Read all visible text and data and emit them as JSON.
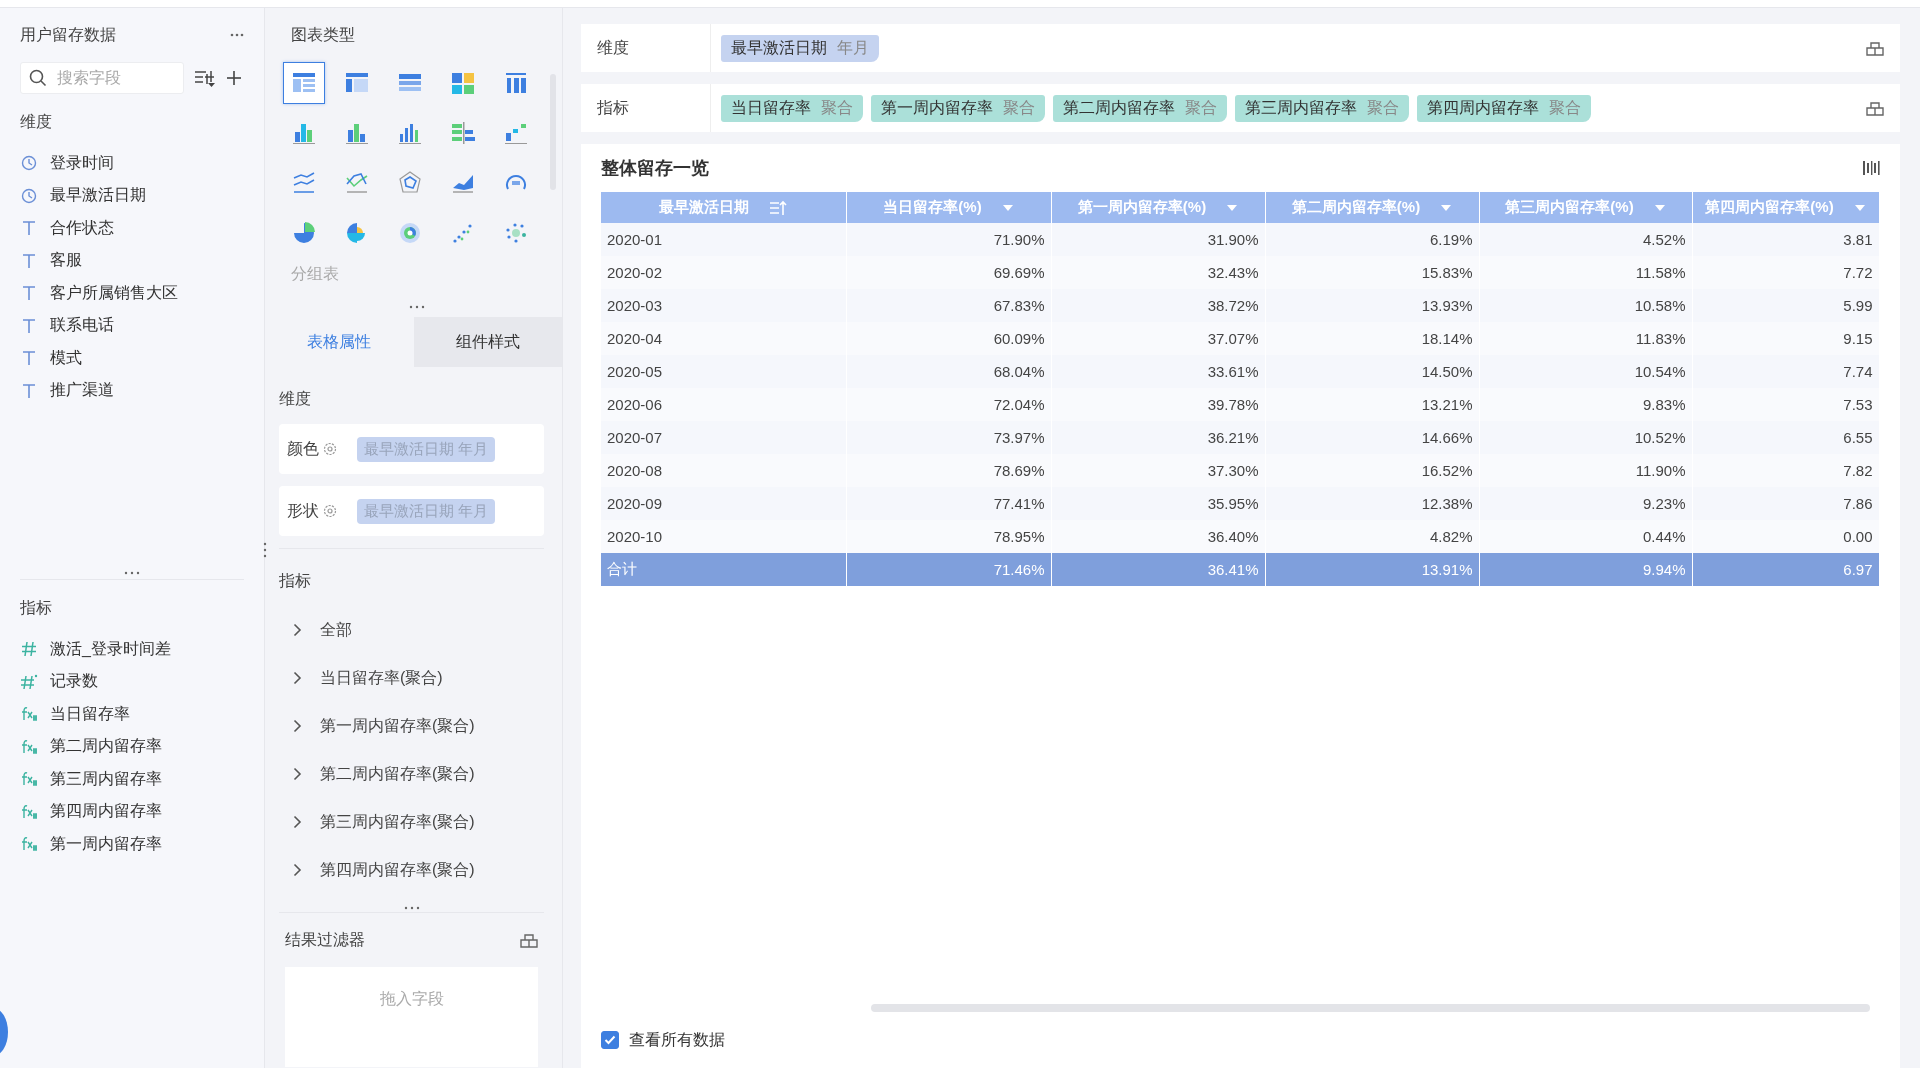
{
  "source": {
    "title": "用户留存数据",
    "search_placeholder": "搜索字段"
  },
  "dimensions": {
    "label": "维度",
    "items": [
      {
        "kind": "date",
        "name": "登录时间"
      },
      {
        "kind": "date",
        "name": "最早激活日期"
      },
      {
        "kind": "text",
        "name": "合作状态"
      },
      {
        "kind": "text",
        "name": "客服"
      },
      {
        "kind": "text",
        "name": "客户所属销售大区"
      },
      {
        "kind": "text",
        "name": "联系电话"
      },
      {
        "kind": "text",
        "name": "模式"
      },
      {
        "kind": "text",
        "name": "推广渠道"
      }
    ]
  },
  "measures": {
    "label": "指标",
    "items": [
      {
        "kind": "number",
        "name": "激活_登录时间差"
      },
      {
        "kind": "count",
        "name": "记录数"
      },
      {
        "kind": "calc",
        "name": "当日留存率"
      },
      {
        "kind": "calc",
        "name": "第二周内留存率"
      },
      {
        "kind": "calc",
        "name": "第三周内留存率"
      },
      {
        "kind": "calc",
        "name": "第四周内留存率"
      },
      {
        "kind": "calc",
        "name": "第一周内留存率"
      }
    ]
  },
  "chart_panel": {
    "title": "图表类型",
    "hint": "分组表",
    "types": [
      {
        "kind": "table",
        "selected": true
      },
      {
        "kind": "cross-table",
        "selected": false
      },
      {
        "kind": "detail-table",
        "selected": false
      },
      {
        "kind": "treemap",
        "selected": false
      },
      {
        "kind": "kpi",
        "selected": false
      },
      {
        "kind": "stacked-column",
        "selected": false
      },
      {
        "kind": "column",
        "selected": false
      },
      {
        "kind": "grouped-column",
        "selected": false
      },
      {
        "kind": "bar",
        "selected": false
      },
      {
        "kind": "waterfall",
        "selected": false
      },
      {
        "kind": "multi-line",
        "selected": false
      },
      {
        "kind": "cross-line",
        "selected": false
      },
      {
        "kind": "radar",
        "selected": false
      },
      {
        "kind": "area",
        "selected": false
      },
      {
        "kind": "gauge",
        "selected": false
      },
      {
        "kind": "pie",
        "selected": false
      },
      {
        "kind": "rose",
        "selected": false
      },
      {
        "kind": "sunburst",
        "selected": false
      },
      {
        "kind": "scatter",
        "selected": false
      },
      {
        "kind": "bubble",
        "selected": false
      }
    ]
  },
  "tabs": [
    {
      "label": "表格属性",
      "selected": true
    },
    {
      "label": "组件样式",
      "selected": false
    }
  ],
  "properties": {
    "dimension_label": "维度",
    "channels": [
      {
        "label": "颜色",
        "field": "最早激活日期 年月"
      },
      {
        "label": "形状",
        "field": "最早激活日期 年月"
      }
    ],
    "measure_label": "指标",
    "measures": [
      {
        "label": "全部",
        "expanded": false
      },
      {
        "label": "当日留存率(聚合)",
        "expanded": false
      },
      {
        "label": "第一周内留存率(聚合)",
        "expanded": false
      },
      {
        "label": "第二周内留存率(聚合)",
        "expanded": false
      },
      {
        "label": "第三周内留存率(聚合)",
        "expanded": false
      },
      {
        "label": "第四周内留存率(聚合)",
        "expanded": false
      }
    ]
  },
  "result_filter": {
    "title": "结果过滤器",
    "placeholder": "拖入字段"
  },
  "shelves": [
    {
      "kind": "dimension",
      "label": "维度",
      "pills": [
        {
          "name": "最早激活日期",
          "agg": "年月"
        }
      ]
    },
    {
      "kind": "measure",
      "label": "指标",
      "pills": [
        {
          "name": "当日留存率",
          "agg": "聚合"
        },
        {
          "name": "第一周内留存率",
          "agg": "聚合"
        },
        {
          "name": "第二周内留存率",
          "agg": "聚合"
        },
        {
          "name": "第三周内留存率",
          "agg": "聚合"
        },
        {
          "name": "第四周内留存率",
          "agg": "聚合"
        }
      ]
    }
  ],
  "table_card": {
    "title": "整体留存一览",
    "columns": [
      {
        "kind": "dimension",
        "label": "最早激活日期"
      },
      {
        "kind": "measure",
        "label": "当日留存率(%)"
      },
      {
        "kind": "measure",
        "label": "第一周内留存率(%)"
      },
      {
        "kind": "measure",
        "label": "第二周内留存率(%)"
      },
      {
        "kind": "measure",
        "label": "第三周内留存率(%)"
      },
      {
        "kind": "measure",
        "label": "第四周内留存率(%)"
      }
    ],
    "rows": [
      [
        "2020-01",
        "71.90%",
        "31.90%",
        "6.19%",
        "4.52%",
        "3.81"
      ],
      [
        "2020-02",
        "69.69%",
        "32.43%",
        "15.83%",
        "11.58%",
        "7.72"
      ],
      [
        "2020-03",
        "67.83%",
        "38.72%",
        "13.93%",
        "10.58%",
        "5.99"
      ],
      [
        "2020-04",
        "60.09%",
        "37.07%",
        "18.14%",
        "11.83%",
        "9.15"
      ],
      [
        "2020-05",
        "68.04%",
        "33.61%",
        "14.50%",
        "10.54%",
        "7.74"
      ],
      [
        "2020-06",
        "72.04%",
        "39.78%",
        "13.21%",
        "9.83%",
        "7.53"
      ],
      [
        "2020-07",
        "73.97%",
        "36.21%",
        "14.66%",
        "10.52%",
        "6.55"
      ],
      [
        "2020-08",
        "78.69%",
        "37.30%",
        "16.52%",
        "11.90%",
        "7.82"
      ],
      [
        "2020-09",
        "77.41%",
        "35.95%",
        "12.38%",
        "9.23%",
        "7.86"
      ],
      [
        "2020-10",
        "78.95%",
        "36.40%",
        "4.82%",
        "0.44%",
        "0.00"
      ]
    ],
    "total": [
      "合计",
      "71.46%",
      "36.41%",
      "13.91%",
      "9.94%",
      "6.97"
    ],
    "show_all": {
      "label": "查看所有数据",
      "checked": true
    }
  }
}
